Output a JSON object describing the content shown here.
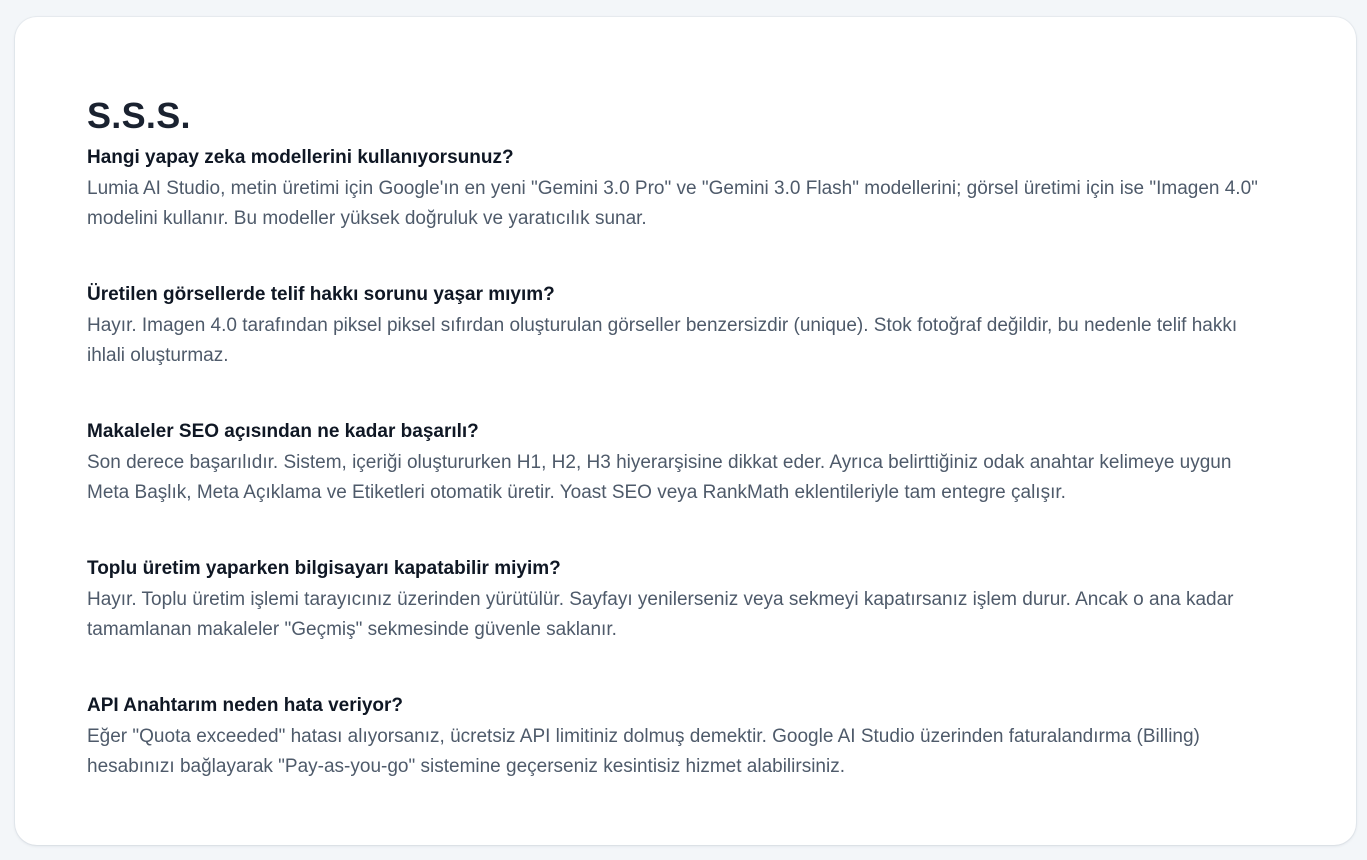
{
  "page": {
    "title": "S.S.S."
  },
  "faq": [
    {
      "question": "Hangi yapay zeka modellerini kullanıyorsunuz?",
      "answer": "Lumia AI Studio, metin üretimi için Google'ın en yeni \"Gemini 3.0 Pro\" ve \"Gemini 3.0 Flash\" modellerini; görsel üretimi için ise \"Imagen 4.0\" modelini kullanır. Bu modeller yüksek doğruluk ve yaratıcılık sunar."
    },
    {
      "question": "Üretilen görsellerde telif hakkı sorunu yaşar mıyım?",
      "answer": "Hayır. Imagen 4.0 tarafından piksel piksel sıfırdan oluşturulan görseller benzersizdir (unique). Stok fotoğraf değildir, bu nedenle telif hakkı ihlali oluşturmaz."
    },
    {
      "question": "Makaleler SEO açısından ne kadar başarılı?",
      "answer": "Son derece başarılıdır. Sistem, içeriği oluştururken H1, H2, H3 hiyerarşisine dikkat eder. Ayrıca belirttiğiniz odak anahtar kelimeye uygun Meta Başlık, Meta Açıklama ve Etiketleri otomatik üretir. Yoast SEO veya RankMath eklentileriyle tam entegre çalışır."
    },
    {
      "question": "Toplu üretim yaparken bilgisayarı kapatabilir miyim?",
      "answer": "Hayır. Toplu üretim işlemi tarayıcınız üzerinden yürütülür. Sayfayı yenilerseniz veya sekmeyi kapatırsanız işlem durur. Ancak o ana kadar tamamlanan makaleler \"Geçmiş\" sekmesinde güvenle saklanır."
    },
    {
      "question": "API Anahtarım neden hata veriyor?",
      "answer": "Eğer \"Quota exceeded\" hatası alıyorsanız, ücretsiz API limitiniz dolmuş demektir. Google AI Studio üzerinden faturalandırma (Billing) hesabınızı bağlayarak \"Pay-as-you-go\" sistemine geçerseniz kesintisiz hizmet alabilirsiniz."
    }
  ]
}
